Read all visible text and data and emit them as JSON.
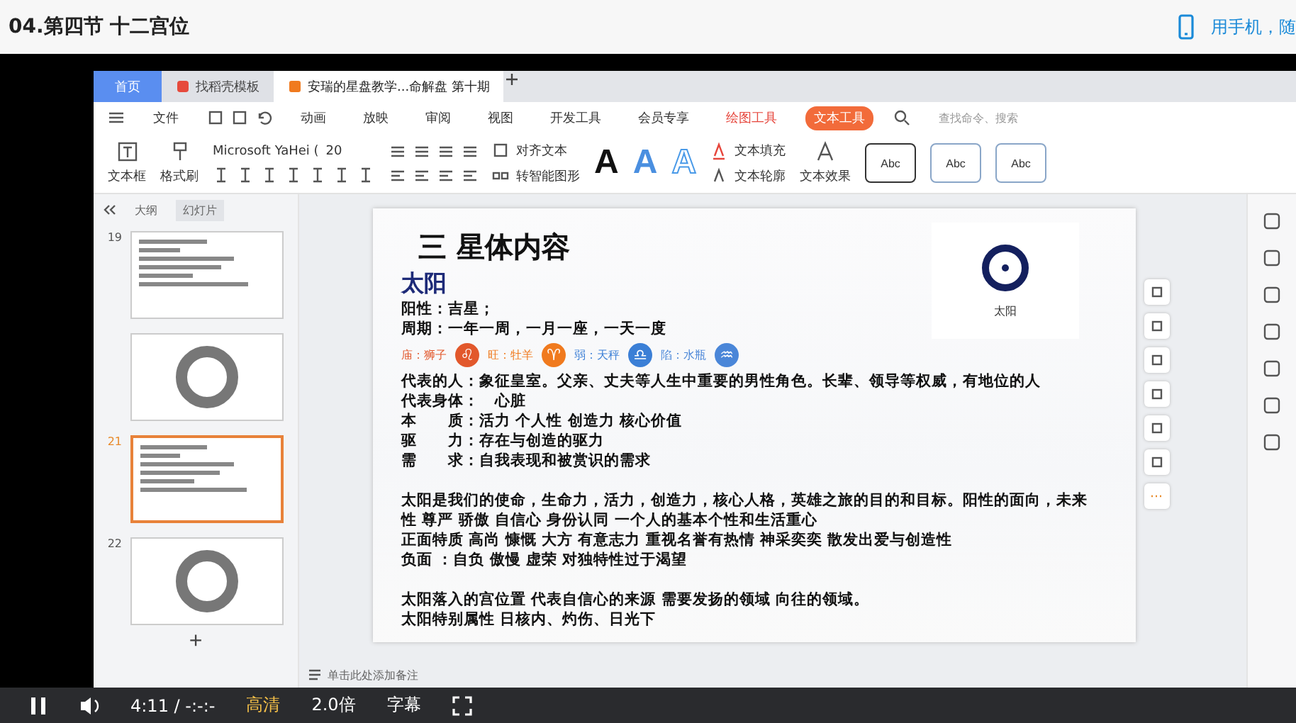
{
  "page": {
    "title": "04.第四节 十二宫位",
    "mobile_link": "用手机，随"
  },
  "wps": {
    "tabs": [
      {
        "label": "首页",
        "selected": false,
        "kind": "home"
      },
      {
        "label": "找稻壳模板",
        "selected": false,
        "kind": "template"
      },
      {
        "label": "安瑞的星盘教学...命解盘 第十期",
        "selected": true,
        "kind": "doc"
      }
    ],
    "menu": [
      {
        "label": "文件",
        "kind": "file",
        "selected": false
      },
      {
        "label": "动画",
        "kind": "plain",
        "selected": false
      },
      {
        "label": "放映",
        "kind": "plain",
        "selected": false
      },
      {
        "label": "审阅",
        "kind": "plain",
        "selected": false
      },
      {
        "label": "视图",
        "kind": "plain",
        "selected": false
      },
      {
        "label": "开发工具",
        "kind": "plain",
        "selected": false
      },
      {
        "label": "会员专享",
        "kind": "plain",
        "selected": false
      },
      {
        "label": "绘图工具",
        "kind": "tool",
        "selected": false
      },
      {
        "label": "文本工具",
        "kind": "tool",
        "selected": true
      }
    ],
    "search_placeholder": "查找命令、搜索",
    "ribbon": {
      "text_box": "文本框",
      "format_painter": "格式刷",
      "font": "Microsoft YaHei (",
      "font_size": "20",
      "align_text": "对齐文本",
      "smart_art": "转智能图形",
      "text_styles": [
        "A",
        "A",
        "A"
      ],
      "text_fill": "文本填充",
      "text_outline": "文本轮廓",
      "text_effect": "文本效果",
      "shape_styles": [
        {
          "label": "Abc",
          "selected": true
        },
        {
          "label": "Abc",
          "selected": false
        },
        {
          "label": "Abc",
          "selected": false
        }
      ]
    },
    "panel_tabs": [
      {
        "label": "大纲",
        "selected": false
      },
      {
        "label": "幻灯片",
        "selected": true
      }
    ],
    "slides": [
      {
        "number": "19",
        "selected": false,
        "kind": "text"
      },
      {
        "selected": false,
        "kind": "wheel"
      },
      {
        "number": "21",
        "selected": true,
        "kind": "text"
      },
      {
        "number": "22",
        "selected": false,
        "kind": "wheel"
      }
    ],
    "add_slide": "+",
    "notes": "单击此处添加备注"
  },
  "slide": {
    "title": "三 星体内容",
    "heading": "太阳",
    "intro": [
      "阳性：吉星；",
      "周期：一年一周，一月一座，一天一度"
    ],
    "dignities": [
      {
        "label": "庙：狮子",
        "symbol": "♌",
        "color": "#e2582c"
      },
      {
        "label": "旺：牡羊",
        "symbol": "♈",
        "color": "#f07a1e"
      },
      {
        "label": "弱：天秤",
        "symbol": "♎",
        "color": "#3b7fd6"
      },
      {
        "label": "陷：水瓶",
        "symbol": "♒",
        "color": "#4a86d8"
      }
    ],
    "traits": [
      "代表的人：象征皇室。父亲、丈夫等人生中重要的男性角色。长辈、领导等权威，有地位的人",
      "代表身体：　心脏",
      "本　　质：活力 个人性 创造力 核心价值",
      "驱　　力：存在与创造的驱力",
      "需　　求：自我表现和被赏识的需求"
    ],
    "meaning": [
      "太阳是我们的使命，生命力，活力，创造力，核心人格，英雄之旅的目的和目标。阳性的面向，未来性 尊严 骄傲 自信心 身份认同 一个人的基本个性和生活重心",
      "正面特质 高尚 慷慨 大方 有意志力 重视名誉有热情 神采奕奕 散发出爱与创造性",
      "负面 ：自负 傲慢 虚荣 对独特性过于渴望"
    ],
    "house": [
      "太阳落入的宫位置 代表自信心的来源 需要发扬的领域 向往的领域。",
      "太阳特别属性 日核内、灼伤、日光下"
    ],
    "image_caption": "太阳"
  },
  "player": {
    "playing": true,
    "time": "4:11 / -:-:-",
    "quality": "高清",
    "speed": "2.0倍",
    "subtitles": "字幕"
  }
}
